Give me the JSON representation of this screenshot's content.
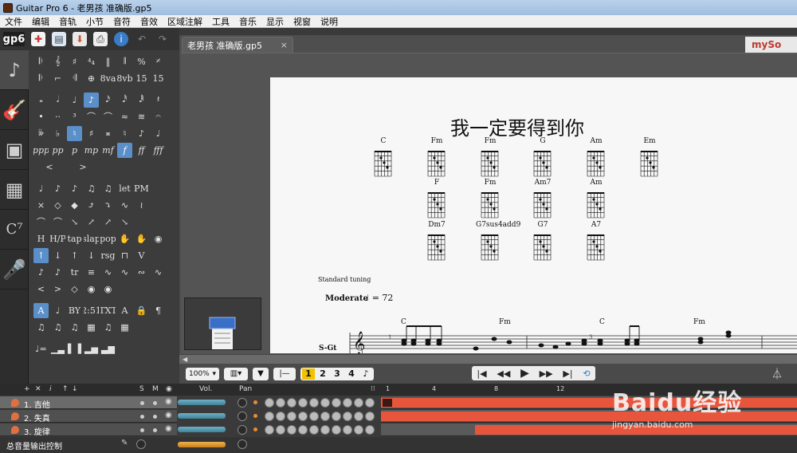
{
  "window": {
    "title": "Guitar Pro 6 - 老男孩 准确版.gp5"
  },
  "menu": [
    "文件",
    "编辑",
    "音轨",
    "小节",
    "音符",
    "音效",
    "区域注解",
    "工具",
    "音乐",
    "显示",
    "视窗",
    "说明"
  ],
  "toolbar": {
    "logo_text": "gp6"
  },
  "document": {
    "tab_label": "老男孩 准确版.gp5",
    "close_glyph": "×",
    "mysongbook_label": "mySo"
  },
  "score": {
    "title": "我一定要得到你",
    "chords_row1": [
      "C",
      "Fm",
      "Fm",
      "G",
      "Am",
      "Em"
    ],
    "chords_row2": [
      "F",
      "Fm",
      "Am7",
      "Am"
    ],
    "chords_row3": [
      "Dm7",
      "G7sus4add9",
      "G7",
      "A7"
    ],
    "tuning": "Standard tuning",
    "tempo_label": "Moderate",
    "tempo_value": "= 72",
    "staff_chords": [
      "C",
      "Fm",
      "C",
      "Fm"
    ],
    "track_abbrev": "S-Gt"
  },
  "bottombar": {
    "zoom": "100%",
    "voices": [
      "1",
      "2",
      "3",
      "4"
    ],
    "active_voice": "1"
  },
  "track_header": {
    "s_label": "S",
    "m_label": "M",
    "vol_label": "Vol.",
    "pan_label": "Pan",
    "add_label": "+",
    "i_label": "i"
  },
  "ruler": [
    "1",
    "4",
    "8",
    "12"
  ],
  "tracks": [
    {
      "label": "1. 吉他"
    },
    {
      "label": "2. 失真"
    },
    {
      "label": "3. 旋律"
    }
  ],
  "master": {
    "label": "总音量输出控制"
  },
  "watermark": {
    "logo": "Baidu经验",
    "url": "jingyan.baidu.com"
  }
}
